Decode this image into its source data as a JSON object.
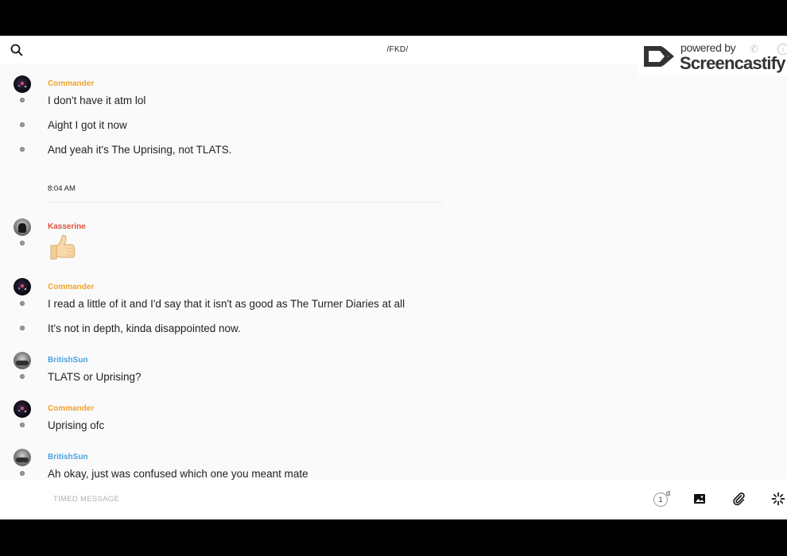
{
  "header": {
    "title": "/FKD/"
  },
  "watermark": {
    "line1": "powered by",
    "line2": "Screencastify",
    "phone_glyph": "✆",
    "info_glyph": "i"
  },
  "messages": {
    "commander_name": "Commander",
    "kasserine_name": "Kasserine",
    "british_name": "BritishSun",
    "m1": "I don't have it atm lol",
    "m2": "Aight I got it now",
    "m3": "And yeah it's The Uprising, not TLATS.",
    "time_separator": "8:04 AM",
    "m5": "I read a little of it and I'd say that it isn't as good as The Turner Diaries at all",
    "m6": "It's not in depth, kinda disappointed now.",
    "m7": "TLATS or Uprising?",
    "m8": "Uprising ofc",
    "m9": "Ah okay, just was confused which one you meant mate"
  },
  "composer": {
    "placeholder": "TIMED MESSAGE",
    "timer_value": "1",
    "timer_unit": "d"
  },
  "icons": {
    "search": "search-icon",
    "image": "image-icon",
    "attach": "paperclip-icon",
    "burst": "sparkle-icon",
    "thumbs_up": "thumbs-up-emoji"
  },
  "colors": {
    "commander": "#f0a32c",
    "kasserine": "#e0513b",
    "british": "#4aa3df"
  }
}
